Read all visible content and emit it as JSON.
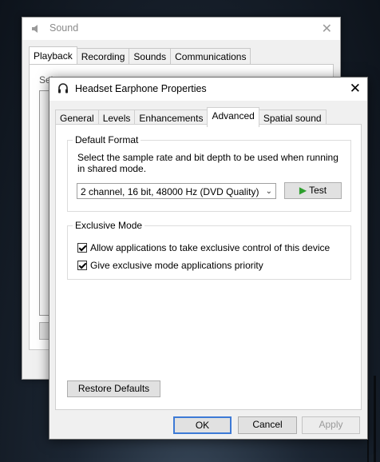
{
  "sound_window": {
    "title": "Sound",
    "tabs": [
      "Playback",
      "Recording",
      "Sounds",
      "Communications"
    ],
    "active_tab": "Playback",
    "partial_text": "Sel"
  },
  "dialog": {
    "title": "Headset Earphone Properties",
    "tabs": [
      {
        "label": "General"
      },
      {
        "label": "Levels"
      },
      {
        "label": "Enhancements"
      },
      {
        "label": "Advanced"
      },
      {
        "label": "Spatial sound"
      }
    ],
    "active_tab": "Advanced",
    "default_format": {
      "legend": "Default Format",
      "description": "Select the sample rate and bit depth to be used when running in shared mode.",
      "selected_format": "2 channel, 16 bit, 48000 Hz (DVD Quality)",
      "test_label": "Test"
    },
    "exclusive_mode": {
      "legend": "Exclusive Mode",
      "options": [
        {
          "label": "Allow applications to take exclusive control of this device",
          "checked": true
        },
        {
          "label": "Give exclusive mode applications priority",
          "checked": true
        }
      ]
    },
    "restore_defaults_label": "Restore Defaults",
    "buttons": {
      "ok": "OK",
      "cancel": "Cancel",
      "apply": "Apply"
    }
  },
  "colors": {
    "accent_focus": "#3d7ad6",
    "play_green": "#2e9f2e"
  }
}
